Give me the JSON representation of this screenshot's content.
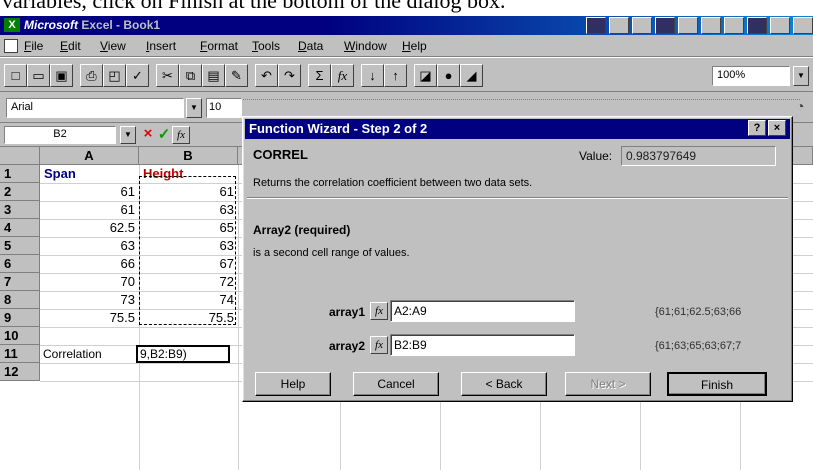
{
  "caption": "variables, click on Finish at the bottom of the dialog box.",
  "window": {
    "brand": "Microsoft",
    "app": "Excel - Book1"
  },
  "menu": [
    "File",
    "Edit",
    "View",
    "Insert",
    "Format",
    "Tools",
    "Data",
    "Window",
    "Help"
  ],
  "toolbar": {
    "sum_label": "Σ",
    "fx_label": "fx",
    "zoom": "100%"
  },
  "format": {
    "font": "Arial",
    "size": "10"
  },
  "formula_bar": {
    "name_box": "B2",
    "cancel_icon": "×",
    "enter_icon": "✓",
    "fx_label": "fx"
  },
  "sheet": {
    "columns": [
      "A",
      "B"
    ],
    "rows": [
      "1",
      "2",
      "3",
      "4",
      "5",
      "6",
      "7",
      "8",
      "9",
      "10",
      "11",
      "12"
    ],
    "header_span": "Span",
    "header_height": "Height",
    "span_values": [
      "61",
      "61",
      "62.5",
      "63",
      "66",
      "70",
      "73",
      "75.5"
    ],
    "height_values": [
      "61",
      "63",
      "65",
      "63",
      "67",
      "72",
      "74",
      "75.5"
    ],
    "correlation_label": "Correlation",
    "edit_text": "9,B2:B9)"
  },
  "dialog": {
    "title": "Function Wizard - Step 2 of 2",
    "help_btn": "?",
    "close_btn": "×",
    "function_name": "CORREL",
    "value_label": "Value:",
    "value": "0.983797649",
    "description": "Returns the correlation coefficient between two data sets.",
    "arg_title": "Array2 (required)",
    "arg_description": "is a second cell range of values.",
    "array1_label": "array1",
    "array1_value": "A2:A9",
    "array1_result": "{61;61;62.5;63;66",
    "array2_label": "array2",
    "array2_value": "B2:B9",
    "array2_result": "{61;63;65;63;67;7",
    "buttons": {
      "help": "Help",
      "cancel": "Cancel",
      "back": "< Back",
      "next": "Next >",
      "finish": "Finish"
    }
  }
}
